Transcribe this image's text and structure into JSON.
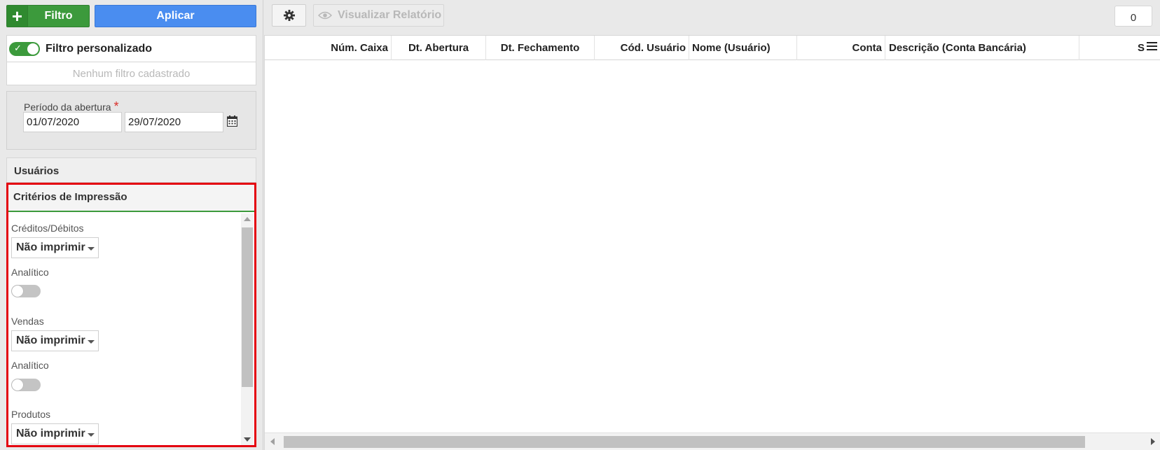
{
  "toolbar_left": {
    "filtro_label": "Filtro",
    "aplicar_label": "Aplicar"
  },
  "filtro_personalizado": {
    "label": "Filtro personalizado",
    "enabled": true,
    "empty_text": "Nenhum filtro cadastrado"
  },
  "periodo": {
    "label": "Período da abertura",
    "required_mark": "*",
    "date_start": "01/07/2020",
    "date_end": "29/07/2020"
  },
  "usuarios": {
    "label": "Usuários"
  },
  "criterios": {
    "title": "Critérios de Impressão",
    "fields": [
      {
        "label": "Créditos/Débitos",
        "value": "Não imprimir"
      },
      {
        "label": "Analítico",
        "enabled": false
      },
      {
        "label": "Vendas",
        "value": "Não imprimir"
      },
      {
        "label": "Analítico",
        "enabled": false
      },
      {
        "label": "Produtos",
        "value": "Não imprimir"
      }
    ]
  },
  "toolbar_right": {
    "visualizar_label": "Visualizar Relatório",
    "count": "0"
  },
  "grid": {
    "columns": [
      "Núm. Caixa",
      "Dt. Abertura",
      "Dt. Fechamento",
      "Cód. Usuário",
      "Nome (Usuário)",
      "Conta",
      "Descrição (Conta Bancária)",
      "S"
    ],
    "rows": []
  },
  "colors": {
    "green": "#3c9a3c",
    "blue": "#4a8df0",
    "highlight_red": "#e4000f",
    "required_red": "#d9302a"
  }
}
